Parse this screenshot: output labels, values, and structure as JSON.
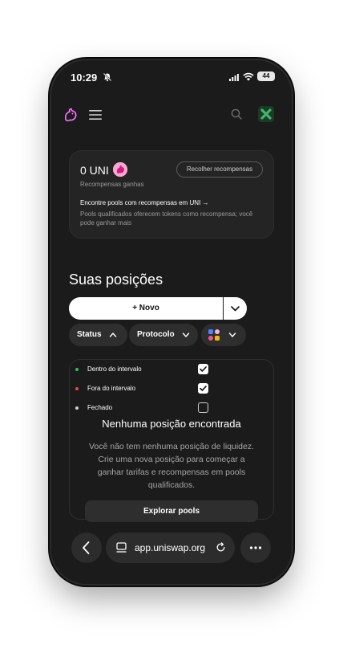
{
  "status_bar": {
    "time": "10:29",
    "battery": "44"
  },
  "rewards": {
    "amount": "0 UNI",
    "caption": "Recompensas ganhas",
    "collect_label": "Recolher recompensas",
    "find_pools_label": "Encontre pools com recompensas em UNI →",
    "description": "Pools qualificados oferecem tokens como recompensa; você pode ganhar mais"
  },
  "positions": {
    "title": "Suas posições",
    "new_label": "+ Novo",
    "filters": {
      "status": "Status",
      "protocol": "Protocolo"
    },
    "status_options": [
      {
        "label": "Dentro do intervalo",
        "checked": true,
        "color": "#22c55e"
      },
      {
        "label": "Fora do intervalo",
        "checked": true,
        "color": "#ef4444"
      },
      {
        "label": "Fechado",
        "checked": false,
        "color": "#d0d0d0"
      }
    ],
    "empty_title": "Nenhuma posição encontrada",
    "empty_description": "Você não tem nenhuma posição de liquidez. Crie uma nova posição para começar a ganhar tarifas e recompensas em pools qualificados.",
    "explore_label": "Explorar pools"
  },
  "browser": {
    "url": "app.uniswap.org"
  },
  "colors": {
    "accent_pink": "#fc72ff",
    "background": "#1b1b1b",
    "surface": "#2e2e2e",
    "wallet_green": "#40b66b"
  },
  "icons": {
    "logo": "uniswap-logo-icon",
    "menu": "menu-icon",
    "search": "search-icon",
    "bell": "bell-slash-icon",
    "back": "chevron-left-icon",
    "reload": "reload-icon",
    "more": "more-dots-icon"
  }
}
